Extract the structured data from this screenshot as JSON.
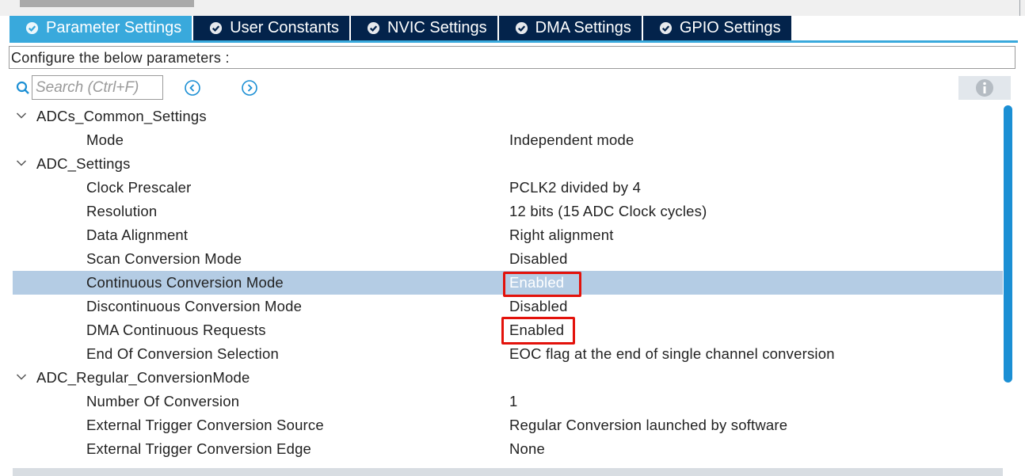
{
  "tabs": [
    {
      "label": "Parameter Settings",
      "active": true
    },
    {
      "label": "User Constants",
      "active": false
    },
    {
      "label": "NVIC Settings",
      "active": false
    },
    {
      "label": "DMA Settings",
      "active": false
    },
    {
      "label": "GPIO Settings",
      "active": false
    }
  ],
  "config_text": "Configure the below parameters :",
  "search": {
    "placeholder": "Search (Ctrl+F)",
    "value": ""
  },
  "tree": {
    "group1": {
      "label": "ADCs_Common_Settings"
    },
    "mode": {
      "label": "Mode",
      "value": "Independent mode"
    },
    "group2": {
      "label": "ADC_Settings"
    },
    "clock_prescaler": {
      "label": "Clock Prescaler",
      "value": "PCLK2 divided by 4"
    },
    "resolution": {
      "label": "Resolution",
      "value": "12 bits (15 ADC Clock cycles)"
    },
    "data_alignment": {
      "label": "Data Alignment",
      "value": "Right alignment"
    },
    "scan_conversion": {
      "label": "Scan Conversion Mode",
      "value": "Disabled"
    },
    "continuous_conversion": {
      "label": "Continuous Conversion Mode",
      "value": "Enabled"
    },
    "discontinuous_conversion": {
      "label": "Discontinuous Conversion Mode",
      "value": "Disabled"
    },
    "dma_continuous": {
      "label": "DMA Continuous Requests",
      "value": "Enabled"
    },
    "eoc_selection": {
      "label": "End Of Conversion Selection",
      "value": "EOC flag at the end of single channel conversion"
    },
    "group3": {
      "label": "ADC_Regular_ConversionMode"
    },
    "number_of_conversion": {
      "label": "Number Of Conversion",
      "value": "1"
    },
    "ext_trigger_source": {
      "label": "External Trigger Conversion Source",
      "value": "Regular Conversion launched by software"
    },
    "ext_trigger_edge": {
      "label": "External Trigger Conversion Edge",
      "value": "None"
    }
  },
  "colors": {
    "tab_inactive": "#03234b",
    "tab_active": "#39a9dc",
    "selected_row": "#b4cce4",
    "highlight_box": "#e3120b",
    "scrollbar": "#1b8fd4"
  }
}
